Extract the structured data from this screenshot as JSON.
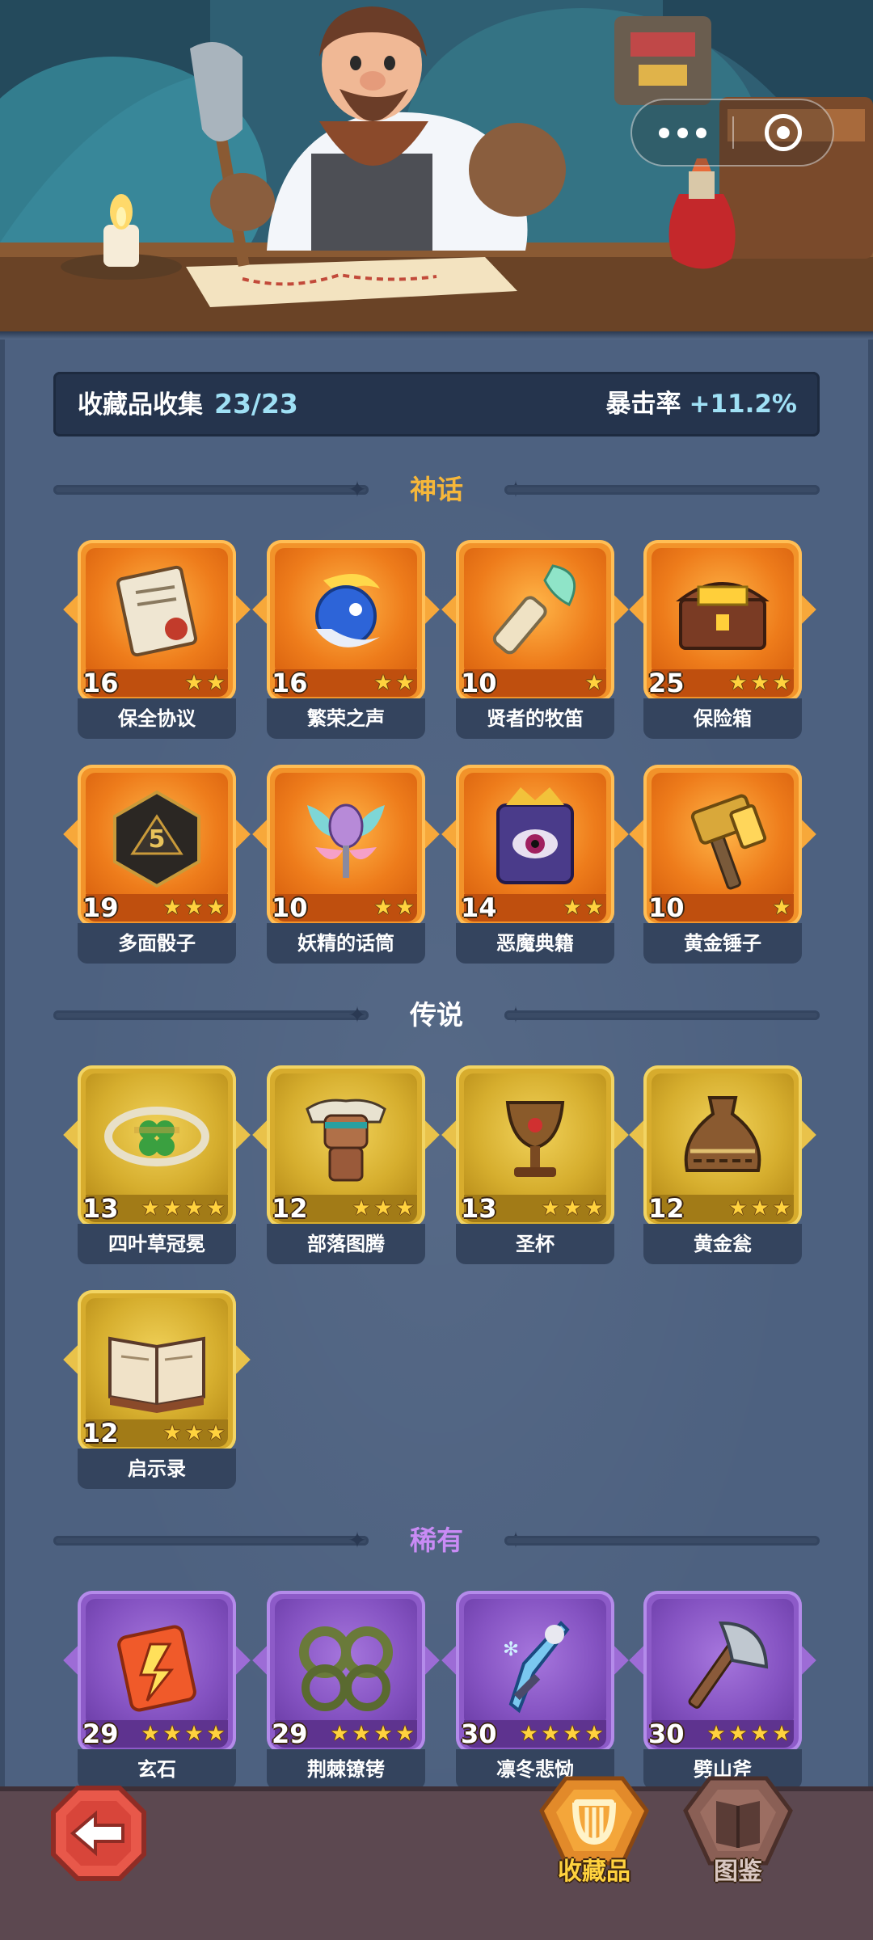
{
  "header": {
    "title": "收藏品收集",
    "count": "23/23",
    "bonus_label": "暴击率",
    "bonus_value": "+11.2%"
  },
  "capsule": {
    "more_icon": "more-dots-icon",
    "close_icon": "target-close-icon"
  },
  "sections": {
    "myth": {
      "title": "神话",
      "title_color": "#f6b73a",
      "items": [
        {
          "name": "保全协议",
          "level": "16",
          "stars": 2,
          "icon": "scroll-contract-icon"
        },
        {
          "name": "繁荣之声",
          "level": "16",
          "stars": 2,
          "icon": "blue-orb-icon"
        },
        {
          "name": "贤者的牧笛",
          "level": "10",
          "stars": 1,
          "icon": "feather-flute-icon"
        },
        {
          "name": "保险箱",
          "level": "25",
          "stars": 3,
          "icon": "treasure-chest-icon"
        },
        {
          "name": "多面骰子",
          "level": "19",
          "stars": 3,
          "icon": "d20-dice-icon"
        },
        {
          "name": "妖精的话筒",
          "level": "10",
          "stars": 2,
          "icon": "fairy-microphone-icon"
        },
        {
          "name": "恶魔典籍",
          "level": "14",
          "stars": 2,
          "icon": "demon-book-icon"
        },
        {
          "name": "黄金锤子",
          "level": "10",
          "stars": 1,
          "icon": "golden-hammer-icon"
        }
      ]
    },
    "legend": {
      "title": "传说",
      "title_color": "#ffffff",
      "items": [
        {
          "name": "四叶草冠冕",
          "level": "13",
          "stars": 4,
          "icon": "clover-crown-icon"
        },
        {
          "name": "部落图腾",
          "level": "12",
          "stars": 3,
          "icon": "tribal-totem-icon"
        },
        {
          "name": "圣杯",
          "level": "13",
          "stars": 3,
          "icon": "holy-grail-icon"
        },
        {
          "name": "黄金瓮",
          "level": "12",
          "stars": 3,
          "icon": "golden-urn-icon"
        },
        {
          "name": "启示录",
          "level": "12",
          "stars": 3,
          "icon": "open-book-icon"
        }
      ]
    },
    "rare": {
      "title": "稀有",
      "title_color": "#c98bf5",
      "items": [
        {
          "name": "玄石",
          "level": "29",
          "stars": 4,
          "icon": "rune-stone-icon"
        },
        {
          "name": "荆棘镣铐",
          "level": "29",
          "stars": 4,
          "icon": "thorn-shackles-icon"
        },
        {
          "name": "凛冬悲恸",
          "level": "30",
          "stars": 4,
          "icon": "frost-sword-icon"
        },
        {
          "name": "劈山斧",
          "level": "30",
          "stars": 4,
          "icon": "battle-axe-icon"
        }
      ]
    }
  },
  "bottom_nav": {
    "back_icon": "back-arrow-icon",
    "collection_label": "收藏品",
    "collection_icon": "lyre-icon",
    "codex_label": "图鉴",
    "codex_icon": "book-icon"
  },
  "colors": {
    "myth_frame": "#f2932a",
    "legend_frame": "#d7ac2d",
    "rare_frame": "#8d5bc8",
    "accent_text": "#9fe0f5"
  }
}
